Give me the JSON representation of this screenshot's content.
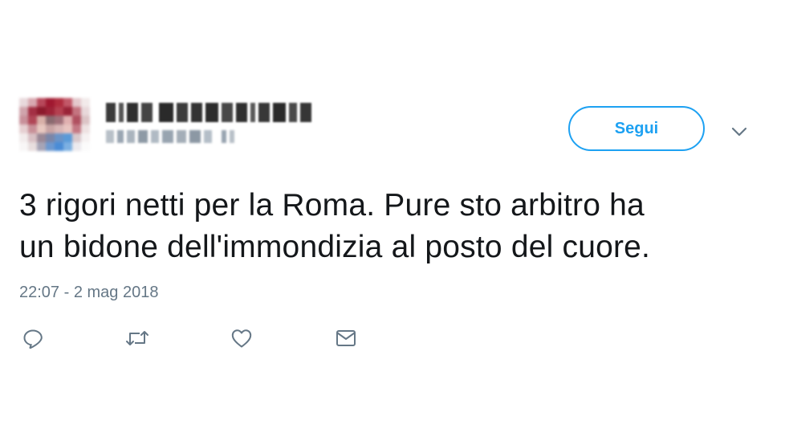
{
  "tweet": {
    "follow_label": "Segui",
    "text_lines": [
      "3 rigori netti per la Roma. Pure sto arbitro ha",
      "un bidone dell'immondizia al posto del cuore."
    ],
    "timestamp": "22:07 - 2 mag 2018"
  },
  "icons": {
    "caret": "chevron-down-icon",
    "reply": "reply-icon",
    "retweet": "retweet-icon",
    "like": "heart-icon",
    "message": "envelope-icon"
  },
  "colors": {
    "accent": "#1da1f2",
    "text": "#14171a",
    "muted": "#657786"
  }
}
